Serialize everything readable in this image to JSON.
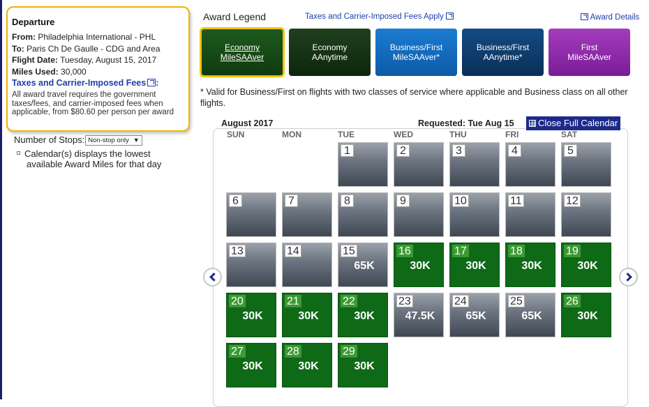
{
  "departure": {
    "title": "Departure",
    "from_label": "From:",
    "from_value": "Philadelphia International - PHL",
    "to_label": "To:",
    "to_value": "Paris Ch De Gaulle - CDG and Area",
    "date_label": "Flight Date:",
    "date_value": "Tuesday, August 15, 2017",
    "miles_label": "Miles Used:",
    "miles_value": "30,000",
    "fees_link": "Taxes and Carrier-Imposed Fees",
    "fees_colon": ":",
    "fees_note": "All award travel requires the government taxes/fees, and carrier-imposed fees when applicable, from $80.60 per person per award"
  },
  "stops": {
    "label": "Number of Stops:",
    "selected": "Non-stop only"
  },
  "calendar_note": {
    "line1": "Calendar(s) displays the lowest",
    "line2": "available Award Miles for that day"
  },
  "legend": {
    "title": "Award Legend",
    "taxes_link": "Taxes and Carrier-Imposed Fees Apply",
    "award_details": "Award Details",
    "items": [
      {
        "l1": "Economy",
        "l2": "MileSAAver",
        "color": "#1e5b1e"
      },
      {
        "l1": "Economy",
        "l2": "AAnytime",
        "color": "#21401f"
      },
      {
        "l1": "Business/First",
        "l2": "MileSAAver*",
        "color": "#1a7cd2"
      },
      {
        "l1": "Business/First",
        "l2": "AAnytime*",
        "color": "#134b83"
      },
      {
        "l1": "First",
        "l2": "MileSAAver",
        "color": "#a33cbc"
      }
    ],
    "note": "* Valid for Business/First on flights with two classes of service where applicable and Business class on all other flights."
  },
  "calendar": {
    "month": "August 2017",
    "requested": "Requested: Tue Aug 15",
    "close_button": "Close Full Calendar",
    "dow": [
      "SUN",
      "MON",
      "TUE",
      "WED",
      "THU",
      "FRI",
      "SAT"
    ],
    "days": [
      {
        "n": "1",
        "v": ""
      },
      {
        "n": "2",
        "v": ""
      },
      {
        "n": "3",
        "v": ""
      },
      {
        "n": "4",
        "v": ""
      },
      {
        "n": "5",
        "v": ""
      },
      {
        "n": "6",
        "v": ""
      },
      {
        "n": "7",
        "v": ""
      },
      {
        "n": "8",
        "v": ""
      },
      {
        "n": "9",
        "v": ""
      },
      {
        "n": "10",
        "v": ""
      },
      {
        "n": "11",
        "v": ""
      },
      {
        "n": "12",
        "v": ""
      },
      {
        "n": "13",
        "v": ""
      },
      {
        "n": "14",
        "v": ""
      },
      {
        "n": "15",
        "v": "65K"
      },
      {
        "n": "16",
        "v": "30K"
      },
      {
        "n": "17",
        "v": "30K"
      },
      {
        "n": "18",
        "v": "30K"
      },
      {
        "n": "19",
        "v": "30K"
      },
      {
        "n": "20",
        "v": "30K"
      },
      {
        "n": "21",
        "v": "30K"
      },
      {
        "n": "22",
        "v": "30K"
      },
      {
        "n": "23",
        "v": "47.5K"
      },
      {
        "n": "24",
        "v": "65K"
      },
      {
        "n": "25",
        "v": "65K"
      },
      {
        "n": "26",
        "v": "30K"
      },
      {
        "n": "27",
        "v": "30K"
      },
      {
        "n": "28",
        "v": "30K"
      },
      {
        "n": "29",
        "v": "30K"
      }
    ]
  }
}
